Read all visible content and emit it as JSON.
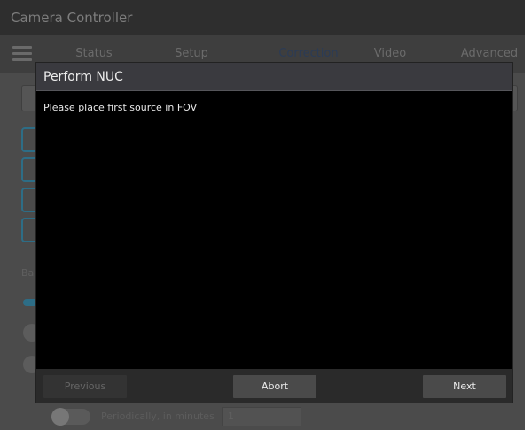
{
  "app": {
    "title": "Camera Controller"
  },
  "tabs": [
    {
      "label": "Status"
    },
    {
      "label": "Setup"
    },
    {
      "label": "Correction",
      "active": true
    },
    {
      "label": "Video"
    },
    {
      "label": "Advanced"
    }
  ],
  "background": {
    "section_label": "Ba",
    "bottom_label": "Periodically, in minutes",
    "bottom_value": "1"
  },
  "dialog": {
    "title": "Perform NUC",
    "message": "Please place first source in FOV",
    "buttons": {
      "previous": "Previous",
      "abort": "Abort",
      "next": "Next"
    }
  },
  "colors": {
    "accent": "#2d6d86",
    "dialog_bg": "#000000",
    "overlay": "#4b4b4b"
  }
}
